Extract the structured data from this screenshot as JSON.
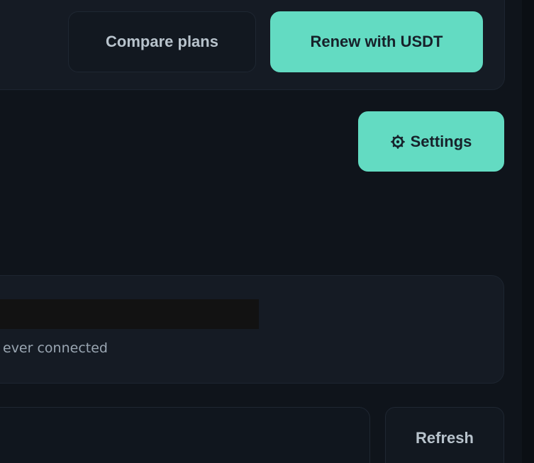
{
  "plan": {
    "compare_label": "Compare plans",
    "renew_label": "Renew with USDT"
  },
  "settings": {
    "icon": "gear-icon",
    "label": "Settings"
  },
  "connection": {
    "status_text": "ever connected"
  },
  "actions": {
    "refresh_label": "Refresh"
  },
  "colors": {
    "accent": "#63dbc2",
    "background": "#0f141b",
    "card": "#151b24"
  }
}
